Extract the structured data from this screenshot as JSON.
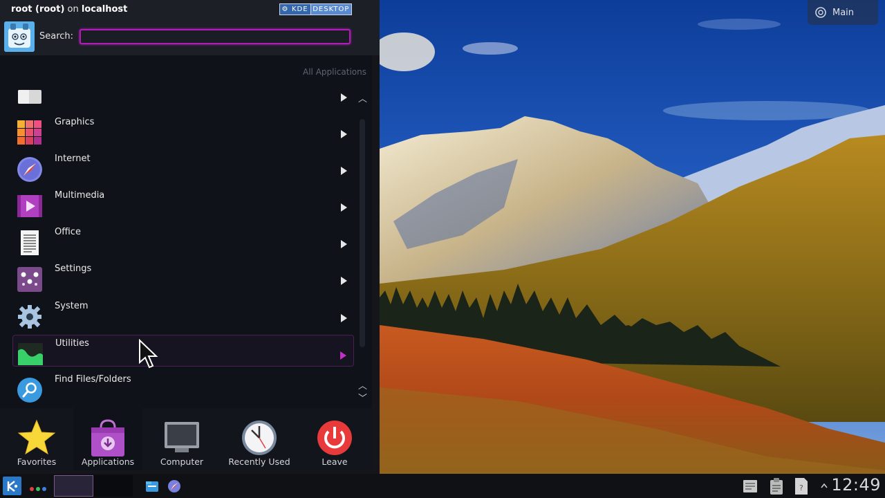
{
  "launcher": {
    "user": "root (root)",
    "on_word": "on",
    "host": "localhost",
    "badge": {
      "kde": "KDE",
      "desktop": "DESKTOP"
    },
    "search": {
      "label": "Search:",
      "value": "",
      "placeholder": ""
    },
    "breadcrumb": "All Applications",
    "items": [
      {
        "label": "",
        "icon": "folder-icon"
      },
      {
        "label": "Graphics",
        "icon": "graphics-icon"
      },
      {
        "label": "Internet",
        "icon": "compass-icon"
      },
      {
        "label": "Multimedia",
        "icon": "multimedia-icon"
      },
      {
        "label": "Office",
        "icon": "document-icon"
      },
      {
        "label": "Settings",
        "icon": "settings-sliders-icon"
      },
      {
        "label": "System",
        "icon": "gear-icon"
      },
      {
        "label": "Utilities",
        "icon": "utilities-icon"
      },
      {
        "label": "Find Files/Folders",
        "icon": "search-icon"
      }
    ],
    "tabs": [
      {
        "label": "Favorites",
        "icon": "star-icon"
      },
      {
        "label": "Applications",
        "icon": "shopping-bag-icon"
      },
      {
        "label": "Computer",
        "icon": "monitor-icon"
      },
      {
        "label": "Recently Used",
        "icon": "clock-icon"
      },
      {
        "label": "Leave",
        "icon": "power-icon"
      }
    ],
    "active_tab": "Applications"
  },
  "desktop": {
    "activity": "Main"
  },
  "taskbar": {
    "clock": "12:49"
  },
  "colors": {
    "accent": "#c020c8",
    "panel": "#14161c",
    "list_bg": "#0f1218"
  }
}
